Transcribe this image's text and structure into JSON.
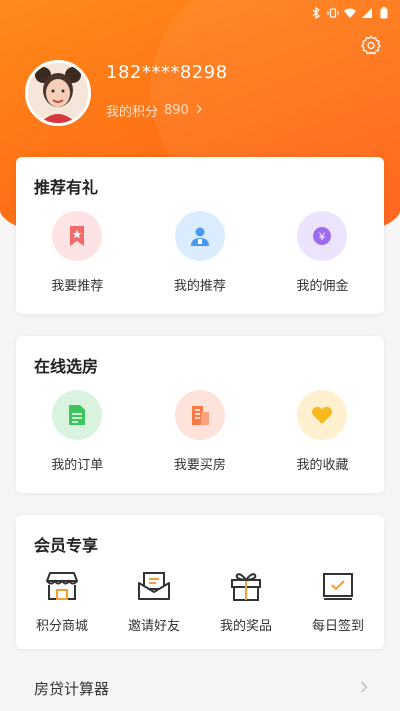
{
  "profile": {
    "phone": "182****8298",
    "points_label": "我的积分",
    "points_value": "890"
  },
  "recommend": {
    "title": "推荐有礼",
    "items": [
      {
        "label": "我要推荐",
        "icon": "bookmark-star-icon",
        "bg": "#fde3e3",
        "fg": "#f26b6b"
      },
      {
        "label": "我的推荐",
        "icon": "person-badge-icon",
        "bg": "#dcecff",
        "fg": "#4a98f0"
      },
      {
        "label": "我的佣金",
        "icon": "coin-icon",
        "bg": "#ece3ff",
        "fg": "#9c6cf0"
      }
    ]
  },
  "online": {
    "title": "在线选房",
    "items": [
      {
        "label": "我的订单",
        "icon": "document-icon",
        "bg": "#daf3de",
        "fg": "#3ec45f"
      },
      {
        "label": "我要买房",
        "icon": "building-icon",
        "bg": "#fde3da",
        "fg": "#f77a46"
      },
      {
        "label": "我的收藏",
        "icon": "heart-icon",
        "bg": "#fff0cf",
        "fg": "#f9b91e"
      }
    ]
  },
  "member": {
    "title": "会员专享",
    "items": [
      {
        "label": "积分商城",
        "icon": "store-icon"
      },
      {
        "label": "邀请好友",
        "icon": "envelope-icon"
      },
      {
        "label": "我的奖品",
        "icon": "gift-icon"
      },
      {
        "label": "每日签到",
        "icon": "checkin-icon"
      }
    ]
  },
  "loan": {
    "label": "房贷计算器"
  },
  "colors": {
    "accent": "#ff7416",
    "icon_dark": "#333333"
  }
}
